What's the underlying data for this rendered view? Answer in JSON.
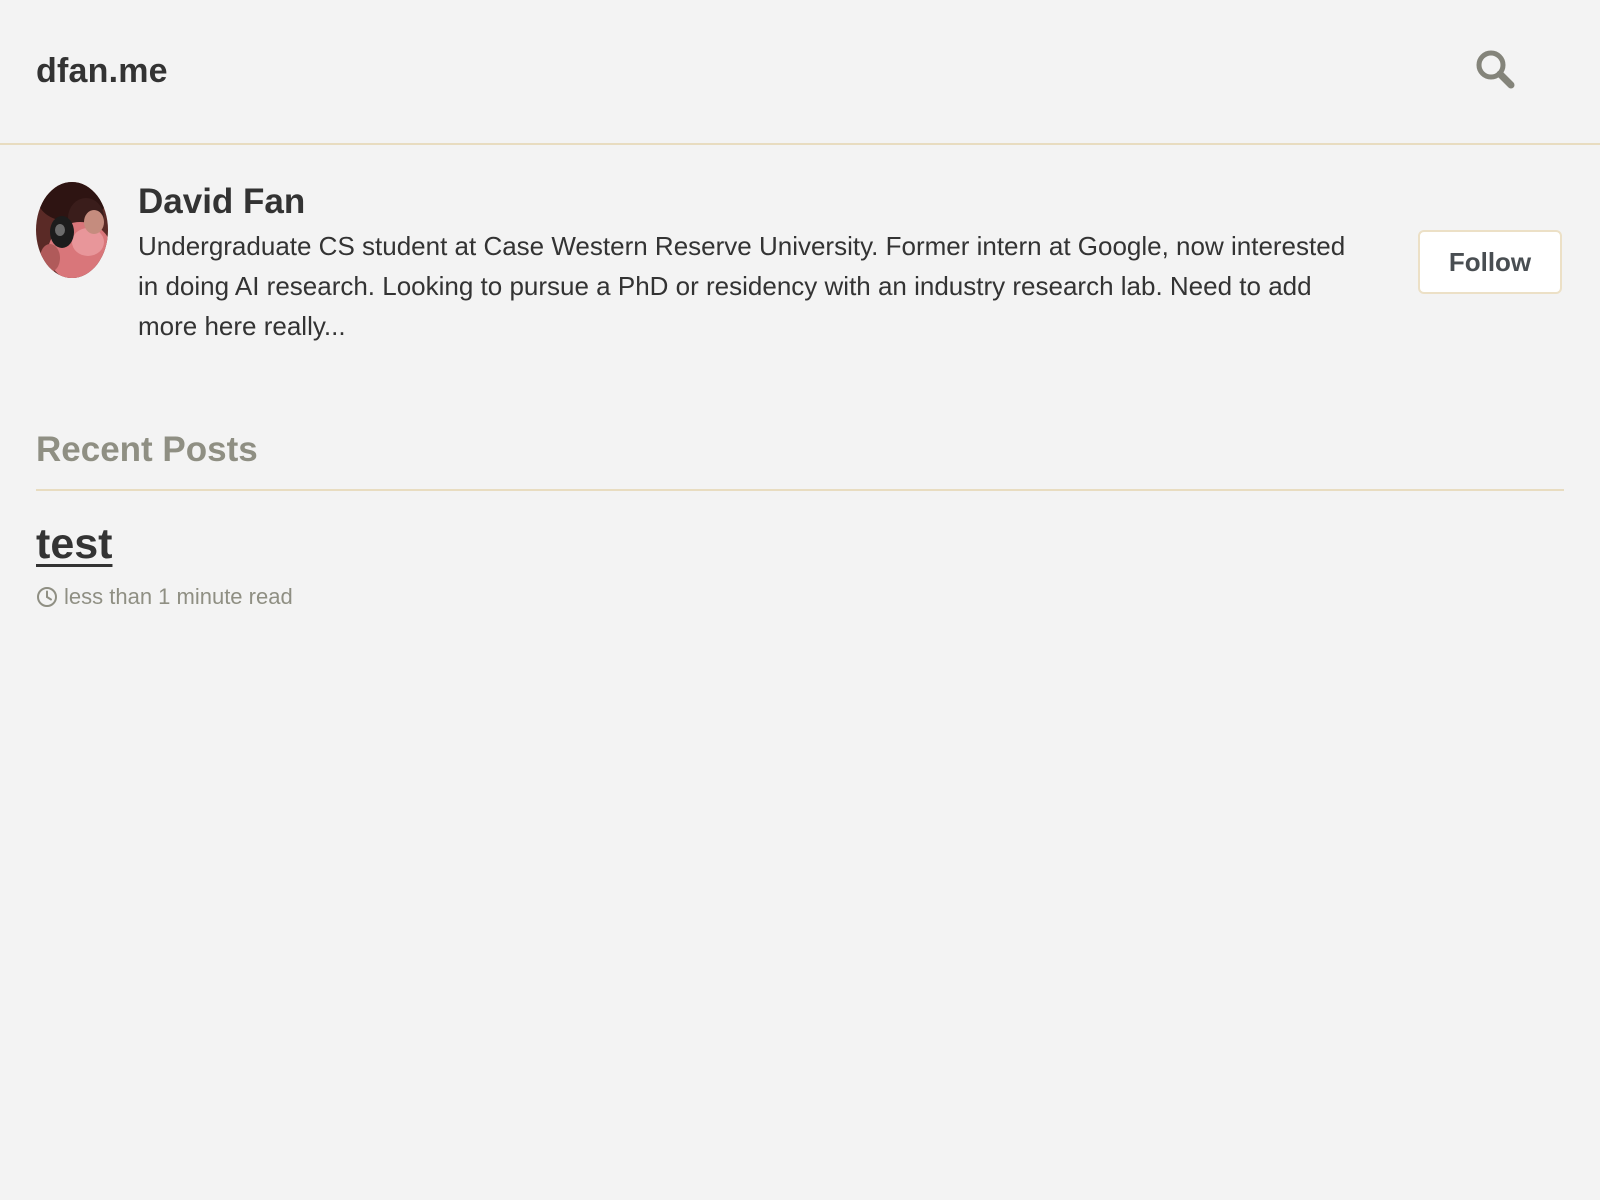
{
  "header": {
    "site_title": "dfan.me",
    "search_icon": "search-icon"
  },
  "author": {
    "name": "David Fan",
    "bio": "Undergraduate CS student at Case Western Reserve University. Former intern at Google, now interested in doing AI research. Looking to pursue a PhD or residency with an industry research lab. Need to add more here really...",
    "follow_label": "Follow"
  },
  "recent_posts": {
    "title": "Recent Posts",
    "items": [
      {
        "title": "test",
        "read_time": "less than 1 minute read",
        "icon": "clock-icon"
      }
    ]
  },
  "colors": {
    "background": "#f3f3f3",
    "text": "#333333",
    "muted": "#8f8f83",
    "rule": "#e8dcc0"
  }
}
